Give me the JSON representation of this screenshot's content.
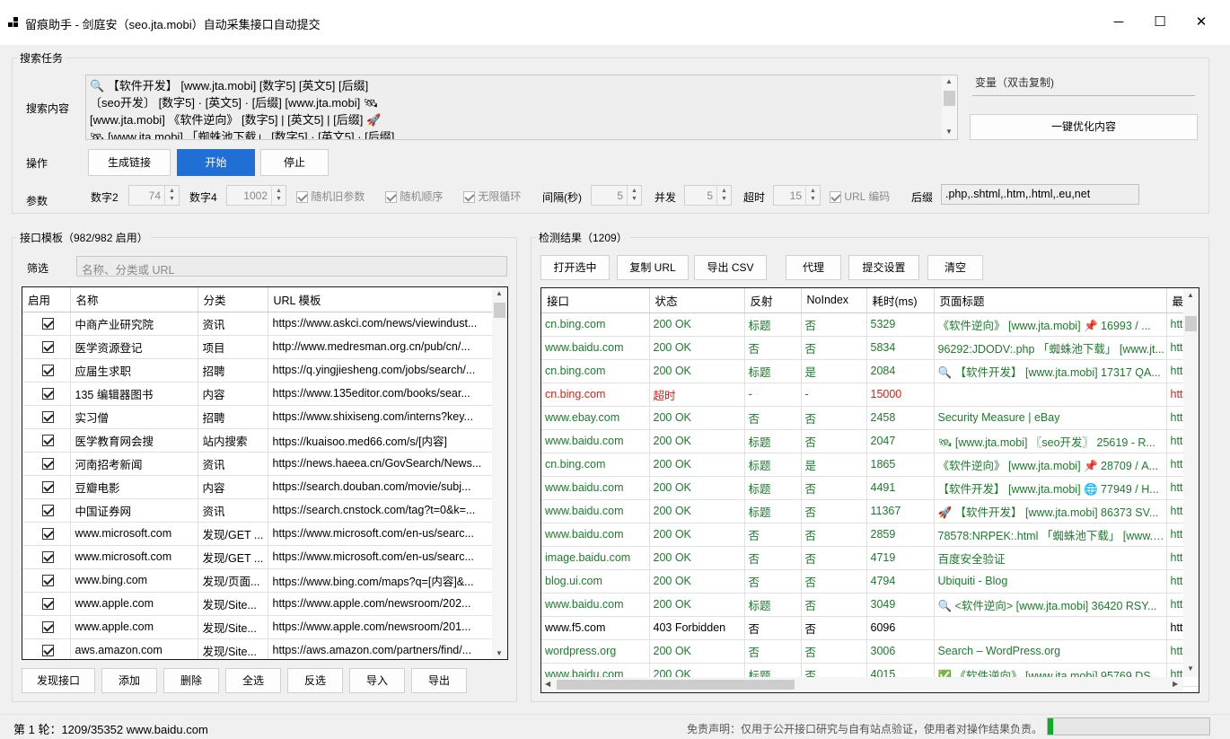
{
  "window": {
    "title": "留痕助手 - 剑庭安（seo.jta.mobi）自动采集接口自动提交",
    "minimize": "─",
    "maximize": "☐",
    "close": "✕"
  },
  "search_task": {
    "group_label": "搜索任务",
    "content_label": "搜索内容",
    "content_lines": [
      "🔍 【软件开发】 [www.jta.mobi] [数字5] [英文5] [后缀]",
      "〔seo开发〕 [数字5] · [英文5] · [后缀] [www.jta.mobi] 🛰",
      "[www.jta.mobi] 《软件逆向》 [数字5] | [英文5] | [后缀] 🚀",
      "🛰 [www.jta.mobi] 「蜘蛛池下载」 [数字5] · [英文5] · [后缀]"
    ],
    "variables_label": "变量（双击复制)",
    "optimize_button": "一键优化内容",
    "ops_label": "操作",
    "buttons": {
      "generate": "生成链接",
      "start": "开始",
      "stop": "停止"
    },
    "params_label": "参数",
    "params": {
      "num2_label": "数字2",
      "num2_value": "74",
      "num4_label": "数字4",
      "num4_value": "1002",
      "random_old": "随机旧参数",
      "random_order": "随机顺序",
      "infinite_loop": "无限循环",
      "interval_label": "间隔(秒)",
      "interval_value": "5",
      "concurrency_label": "并发",
      "concurrency_value": "5",
      "timeout_label": "超时",
      "timeout_value": "15",
      "url_encode": "URL 编码",
      "suffix_label": "后缀",
      "suffix_value": ".php,.shtml,.htm,.html,.eu,net"
    }
  },
  "templates": {
    "group_label": "接口模板（982/982 启用）",
    "filter_label": "筛选",
    "filter_placeholder": "名称、分类或 URL",
    "columns": [
      "启用",
      "名称",
      "分类",
      "URL 模板"
    ],
    "rows": [
      {
        "name": "中商产业研究院",
        "category": "资讯",
        "url": "https://www.askci.com/news/viewindust..."
      },
      {
        "name": "医学资源登记",
        "category": "项目",
        "url": "http://www.medresman.org.cn/pub/cn/..."
      },
      {
        "name": "应届生求职",
        "category": "招聘",
        "url": "https://q.yingjiesheng.com/jobs/search/..."
      },
      {
        "name": "135 编辑器图书",
        "category": "内容",
        "url": "https://www.135editor.com/books/sear..."
      },
      {
        "name": "实习僧",
        "category": "招聘",
        "url": "https://www.shixiseng.com/interns?key..."
      },
      {
        "name": "医学教育网会搜",
        "category": "站内搜索",
        "url": "https://kuaisoo.med66.com/s/[内容]"
      },
      {
        "name": "河南招考新闻",
        "category": "资讯",
        "url": "https://news.haeea.cn/GovSearch/News..."
      },
      {
        "name": "豆瓣电影",
        "category": "内容",
        "url": "https://search.douban.com/movie/subj..."
      },
      {
        "name": "中国证券网",
        "category": "资讯",
        "url": "https://search.cnstock.com/tag?t=0&k=..."
      },
      {
        "name": "www.microsoft.com",
        "category": "发现/GET ...",
        "url": "https://www.microsoft.com/en-us/searc..."
      },
      {
        "name": "www.microsoft.com",
        "category": "发现/GET ...",
        "url": "https://www.microsoft.com/en-us/searc..."
      },
      {
        "name": "www.bing.com",
        "category": "发现/页面...",
        "url": "https://www.bing.com/maps?q=[内容]&..."
      },
      {
        "name": "www.apple.com",
        "category": "发现/Site...",
        "url": "https://www.apple.com/newsroom/202..."
      },
      {
        "name": "www.apple.com",
        "category": "发现/Site...",
        "url": "https://www.apple.com/newsroom/201..."
      },
      {
        "name": "aws.amazon.com",
        "category": "发现/Site...",
        "url": "https://aws.amazon.com/partners/find/..."
      }
    ],
    "buttons": [
      "发现接口",
      "添加",
      "删除",
      "全选",
      "反选",
      "导入",
      "导出"
    ]
  },
  "results": {
    "group_label": "检测结果（1209）",
    "buttons": [
      "打开选中",
      "复制 URL",
      "导出 CSV",
      "代理",
      "提交设置",
      "清空"
    ],
    "columns": [
      "接口",
      "状态",
      "反射",
      "NoIndex",
      "耗时(ms)",
      "页面标题",
      "最"
    ],
    "rows": [
      {
        "api": "cn.bing.com",
        "status": "200 OK",
        "reflect": "标题",
        "noindex": "否",
        "ms": "5329",
        "title": "《软件逆向》 [www.jta.mobi] 📌 16993 / ...",
        "url": "htt",
        "tone": "g"
      },
      {
        "api": "www.baidu.com",
        "status": "200 OK",
        "reflect": "否",
        "noindex": "否",
        "ms": "5834",
        "title": "96292:JDODV:.php 「蜘蛛池下载」 [www.jt...",
        "url": "htt",
        "tone": "g"
      },
      {
        "api": "cn.bing.com",
        "status": "200 OK",
        "reflect": "标题",
        "noindex": "是",
        "ms": "2084",
        "title": "🔍 【软件开发】 [www.jta.mobi] 17317 QA...",
        "url": "htt",
        "tone": "g"
      },
      {
        "api": "cn.bing.com",
        "status": "超时",
        "reflect": "-",
        "noindex": "-",
        "ms": "15000",
        "title": "",
        "url": "htt",
        "tone": "r"
      },
      {
        "api": "www.ebay.com",
        "status": "200 OK",
        "reflect": "否",
        "noindex": "否",
        "ms": "2458",
        "title": "Security Measure | eBay",
        "url": "htt",
        "tone": "g"
      },
      {
        "api": "www.baidu.com",
        "status": "200 OK",
        "reflect": "标题",
        "noindex": "否",
        "ms": "2047",
        "title": "🛰 [www.jta.mobi] 〖seo开发〗 25619 - R...",
        "url": "htt",
        "tone": "g"
      },
      {
        "api": "cn.bing.com",
        "status": "200 OK",
        "reflect": "标题",
        "noindex": "是",
        "ms": "1865",
        "title": "《软件逆向》 [www.jta.mobi] 📌 28709 / A...",
        "url": "htt",
        "tone": "g"
      },
      {
        "api": "www.baidu.com",
        "status": "200 OK",
        "reflect": "标题",
        "noindex": "否",
        "ms": "4491",
        "title": "【软件开发】 [www.jta.mobi] 🌐 77949 / H...",
        "url": "htt",
        "tone": "g"
      },
      {
        "api": "www.baidu.com",
        "status": "200 OK",
        "reflect": "标题",
        "noindex": "否",
        "ms": "11367",
        "title": "🚀 【软件开发】 [www.jta.mobi] 86373 SV...",
        "url": "htt",
        "tone": "g"
      },
      {
        "api": "www.baidu.com",
        "status": "200 OK",
        "reflect": "否",
        "noindex": "否",
        "ms": "2859",
        "title": "78578:NRPEK:.html 「蜘蛛池下载」 [www.jt...",
        "url": "htt",
        "tone": "g"
      },
      {
        "api": "image.baidu.com",
        "status": "200 OK",
        "reflect": "否",
        "noindex": "否",
        "ms": "4719",
        "title": "百度安全验证",
        "url": "htt",
        "tone": "g"
      },
      {
        "api": "blog.ui.com",
        "status": "200 OK",
        "reflect": "否",
        "noindex": "否",
        "ms": "4794",
        "title": "Ubiquiti - Blog",
        "url": "htt",
        "tone": "g"
      },
      {
        "api": "www.baidu.com",
        "status": "200 OK",
        "reflect": "标题",
        "noindex": "否",
        "ms": "3049",
        "title": "🔍 <软件逆向> [www.jta.mobi] 36420 RSY...",
        "url": "htt",
        "tone": "g"
      },
      {
        "api": "www.f5.com",
        "status": "403 Forbidden",
        "reflect": "否",
        "noindex": "否",
        "ms": "6096",
        "title": "",
        "url": "htt",
        "tone": "k"
      },
      {
        "api": "wordpress.org",
        "status": "200 OK",
        "reflect": "否",
        "noindex": "否",
        "ms": "3006",
        "title": "Search – WordPress.org",
        "url": "htt",
        "tone": "g"
      },
      {
        "api": "www.baidu.com",
        "status": "200 OK",
        "reflect": "标题",
        "noindex": "否",
        "ms": "4015",
        "title": "✅ 《软件逆向》 [www.jta.mobi] 95769 DS...",
        "url": "htt",
        "tone": "g"
      }
    ]
  },
  "status_bar": {
    "progress_text": "第 1 轮：1209/35352 www.baidu.com",
    "disclaimer": "免责声明：仅用于公开接口研究与自有站点验证，使用者对操作结果负责。",
    "progress_fraction": 0.034
  },
  "colors": {
    "accent": "#1f6fd4",
    "ok_green": "#1e7a2c",
    "error_red": "#d0261c",
    "progress_green": "#06b025"
  }
}
